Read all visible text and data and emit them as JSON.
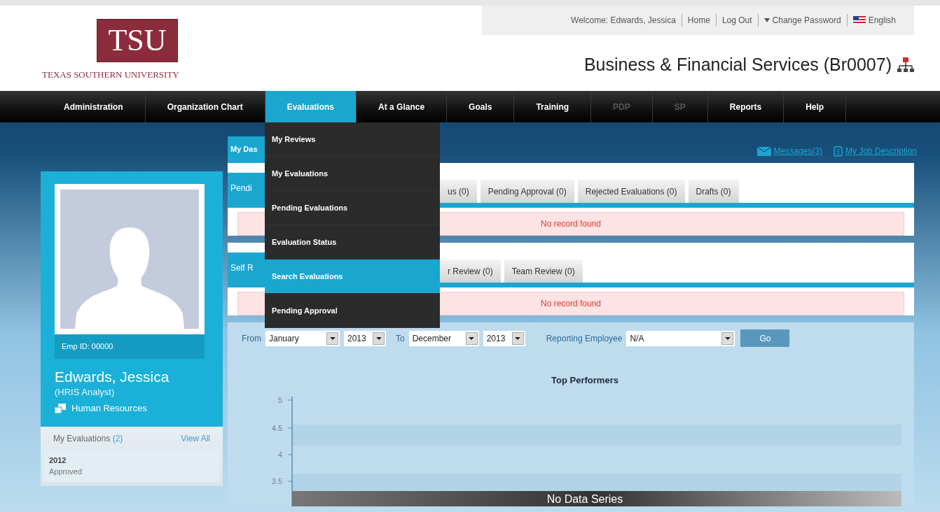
{
  "header": {
    "logo_text": "TSU",
    "university_name": "TEXAS SOUTHERN UNIVERSITY",
    "user_links": [
      {
        "label": "Welcome: Edwards, Jessica",
        "kind": "text"
      },
      {
        "label": "Home",
        "kind": "link"
      },
      {
        "label": "Log Out",
        "kind": "link"
      },
      {
        "label": "Change Password",
        "kind": "dropdown"
      },
      {
        "label": "English",
        "kind": "language"
      }
    ],
    "department": "Business & Financial Services (Br0007)"
  },
  "nav": [
    {
      "label": "Administration",
      "selected": false,
      "disabled": false
    },
    {
      "label": "Organization Chart",
      "selected": false,
      "disabled": false
    },
    {
      "label": "Evaluations",
      "selected": true,
      "disabled": false
    },
    {
      "label": "At a Glance",
      "selected": false,
      "disabled": false
    },
    {
      "label": "Goals",
      "selected": false,
      "disabled": false
    },
    {
      "label": "Training",
      "selected": false,
      "disabled": false
    },
    {
      "label": "PDP",
      "selected": false,
      "disabled": true
    },
    {
      "label": "SP",
      "selected": false,
      "disabled": true
    },
    {
      "label": "Reports",
      "selected": false,
      "disabled": false
    },
    {
      "label": "Help",
      "selected": false,
      "disabled": false
    }
  ],
  "nav_menu": [
    {
      "label": "My Reviews",
      "selected": false
    },
    {
      "label": "My Evaluations",
      "selected": false
    },
    {
      "label": "Pending Evaluations",
      "selected": false
    },
    {
      "label": "Evaluation Status",
      "selected": false
    },
    {
      "label": "Search Evaluations",
      "selected": true
    },
    {
      "label": "Pending Approval",
      "selected": false
    }
  ],
  "profile": {
    "emp_id": "Emp ID: 00000",
    "name": "Edwards, Jessica",
    "title": "(HRIS Analyst)",
    "department": "Human Resources"
  },
  "my_evaluations": {
    "title": "My Evaluations",
    "count": "(2)",
    "view_all": "View All",
    "items": [
      {
        "year": "2012",
        "status": "Approved"
      }
    ]
  },
  "dashboard": {
    "tab": "My Das",
    "links": [
      {
        "label": "Messages(3)",
        "kind": "mail"
      },
      {
        "label": "My Job Description",
        "kind": "document"
      }
    ],
    "sections": [
      {
        "tabs_before_menu": [
          {
            "label": "Pendi",
            "selected": true
          }
        ],
        "tabs_after_menu": [
          {
            "label": "us (0)",
            "selected": false
          },
          {
            "label": "Pending Approval (0)",
            "selected": false
          },
          {
            "label": "Rejected Evaluations (0)",
            "selected": false
          },
          {
            "label": "Drafts (0)",
            "selected": false
          }
        ],
        "message": "No record found"
      },
      {
        "tabs_before_menu": [
          {
            "label": "Self R",
            "selected": true
          }
        ],
        "tabs_after_menu": [
          {
            "label": "r Review (0)",
            "selected": false
          },
          {
            "label": "Team Review (0)",
            "selected": false
          }
        ],
        "message": "No record found"
      }
    ]
  },
  "filter": {
    "from_label": "From",
    "from_month": "January",
    "from_year": "2013",
    "to_label": "To",
    "to_month": "December",
    "to_year": "2013",
    "employee_label": "Reporting Employee",
    "employee": "N/A",
    "go": "Go"
  },
  "chart": {
    "title": "Top Performers",
    "y_ticks": [
      "5",
      "4.5",
      "4",
      "3.5"
    ],
    "message": "No Data Series"
  }
}
